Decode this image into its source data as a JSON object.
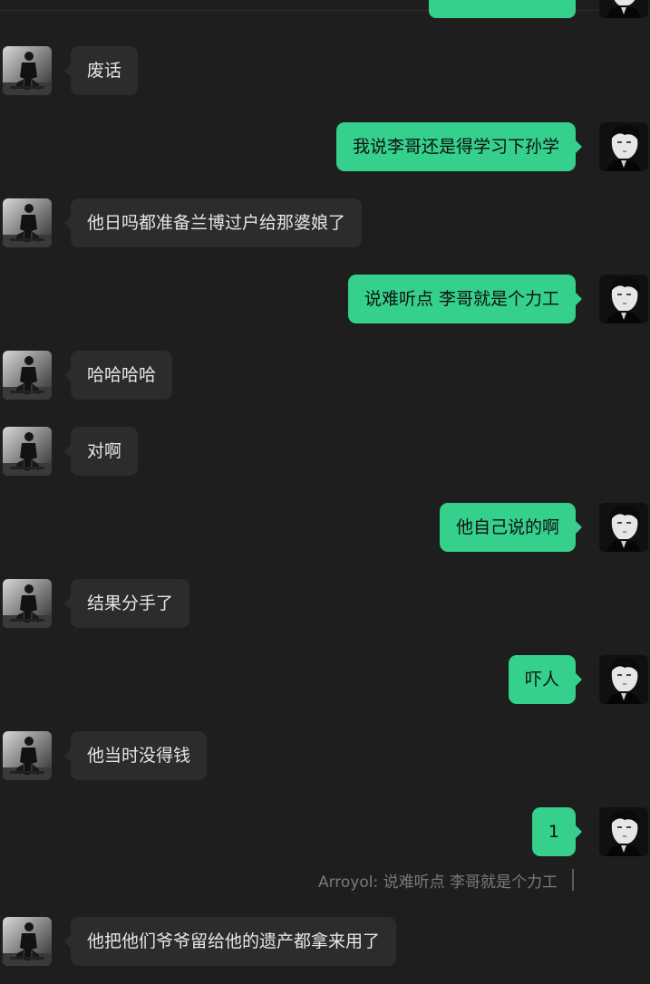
{
  "chat": {
    "messages": [
      {
        "side": "left",
        "text": "废话"
      },
      {
        "side": "right",
        "text": "我说李哥还是得学习下孙学"
      },
      {
        "side": "left",
        "text": "他日吗都准备兰博过户给那婆娘了"
      },
      {
        "side": "right",
        "text": "说难听点 李哥就是个力工"
      },
      {
        "side": "left",
        "text": "哈哈哈哈"
      },
      {
        "side": "left",
        "text": "对啊"
      },
      {
        "side": "right",
        "text": "他自己说的啊"
      },
      {
        "side": "left",
        "text": "结果分手了"
      },
      {
        "side": "right",
        "text": "吓人"
      },
      {
        "side": "left",
        "text": "他当时没得钱"
      },
      {
        "side": "right",
        "text": "1"
      },
      {
        "side": "left",
        "text": "他把他们爷爷留给他的遗产都拿来用了"
      }
    ],
    "quote": {
      "text": "Arroyol: 说难听点 李哥就是个力工"
    }
  },
  "colors": {
    "background": "#1e1e1e",
    "incoming_bubble": "#2c2c2c",
    "outgoing_bubble": "#34d08c",
    "quote_text": "#7a7a7a"
  },
  "icons": {
    "incoming_avatar": "contact-avatar-photo",
    "outgoing_avatar": "self-avatar-illustration"
  }
}
